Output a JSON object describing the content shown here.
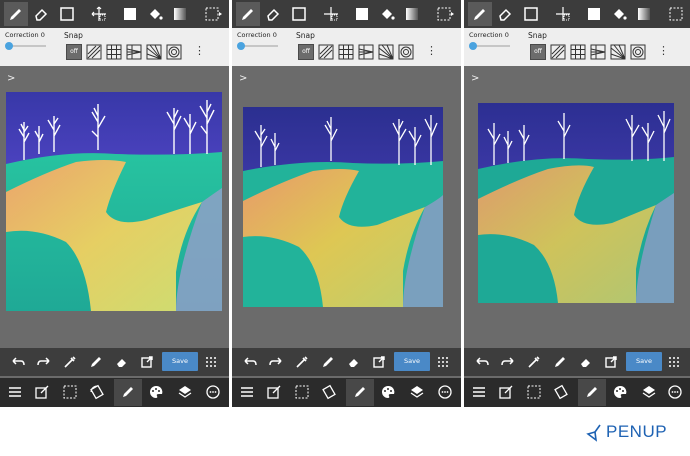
{
  "panels": [
    {
      "id": "panel-1",
      "toolbar_icons": [
        "pencil-icon",
        "eraser-icon",
        "rectangle-select-icon",
        "move-transform-icon",
        "fill-rect-icon",
        "paint-bucket-icon",
        "gradient-icon",
        "layer-select-icon"
      ],
      "correction_label": "Correction",
      "correction_value": "0",
      "snap_label": "Snap",
      "snap_options": [
        "off",
        "parallel-lines-icon",
        "grid-icon",
        "perspective-icon",
        "vanishing-lines-icon",
        "concentric-circle-icon"
      ],
      "action_icons": [
        "undo-icon",
        "redo-icon",
        "eyedropper-icon",
        "pencil-icon",
        "eraser-icon",
        "external-icon"
      ],
      "save_label": "Save",
      "bottom_icons": [
        "menu-icon",
        "edit-icon",
        "selection-icon",
        "rotate-icon",
        "pencil-icon",
        "palette-icon",
        "layers-icon",
        "more-circle-icon"
      ]
    },
    {
      "id": "panel-2",
      "correction_label": "Correction",
      "correction_value": "0",
      "snap_label": "Snap",
      "save_label": "Save"
    },
    {
      "id": "panel-3",
      "correction_label": "Correction",
      "correction_value": "0",
      "snap_label": "Snap",
      "save_label": "Save"
    }
  ],
  "branding": {
    "logo_text": "PENUP",
    "logo_color": "#1e62b3"
  },
  "colors": {
    "toolbar": "#3c3c3c",
    "option_bar": "#eeeeee",
    "workspace": "#6b6b6b",
    "accent": "#4a89c7",
    "bottom_bar": "#2b2b2b"
  }
}
